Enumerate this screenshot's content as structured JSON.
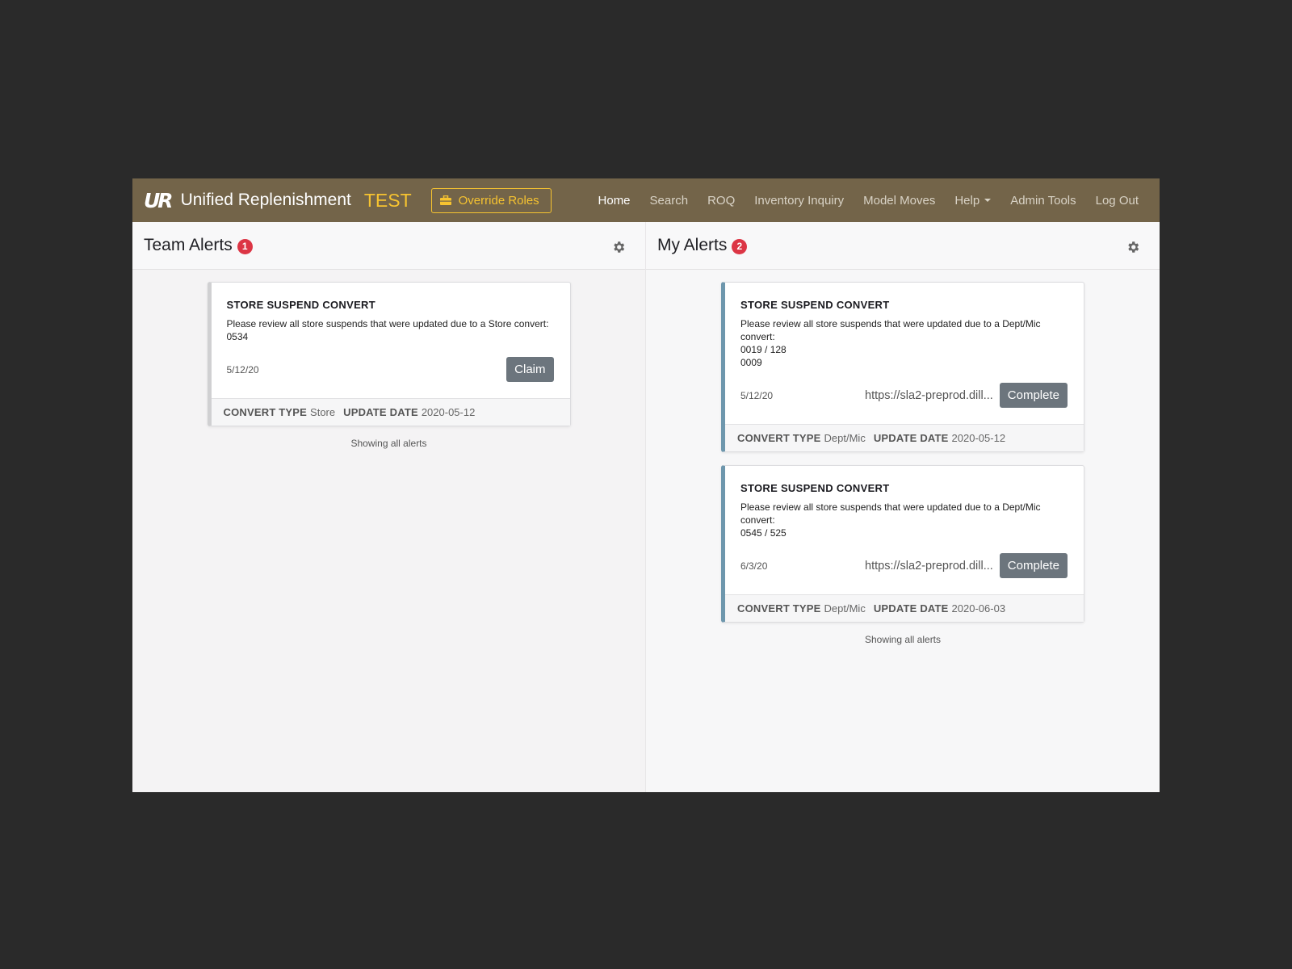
{
  "navbar": {
    "logo": "UR",
    "app_name": "Unified Replenishment",
    "env_tag": "TEST",
    "override_label": "Override Roles",
    "links": [
      "Home",
      "Search",
      "ROQ",
      "Inventory Inquiry",
      "Model Moves",
      "Help",
      "Admin Tools",
      "Log Out"
    ],
    "active": "Home"
  },
  "team_alerts": {
    "title": "Team Alerts",
    "count": "1",
    "cards": [
      {
        "title": "STORE SUSPEND CONVERT",
        "text": "Please review all store suspends that were updated due to a Store convert:\n0534",
        "date": "5/12/20",
        "action": "Claim",
        "convert_type_key": "CONVERT TYPE",
        "convert_type": "Store",
        "update_date_key": "UPDATE DATE",
        "update_date": "2020-05-12"
      }
    ],
    "footer": "Showing all alerts"
  },
  "my_alerts": {
    "title": "My Alerts",
    "count": "2",
    "cards": [
      {
        "title": "STORE SUSPEND CONVERT",
        "text": "Please review all store suspends that were updated due to a Dept/Mic convert:\n0019 / 128\n0009",
        "date": "5/12/20",
        "link": "https://sla2-preprod.dill...",
        "action": "Complete",
        "convert_type_key": "CONVERT TYPE",
        "convert_type": "Dept/Mic",
        "update_date_key": "UPDATE DATE",
        "update_date": "2020-05-12"
      },
      {
        "title": "STORE SUSPEND CONVERT",
        "text": "Please review all store suspends that were updated due to a Dept/Mic convert:\n0545 / 525",
        "date": "6/3/20",
        "link": "https://sla2-preprod.dill...",
        "action": "Complete",
        "convert_type_key": "CONVERT TYPE",
        "convert_type": "Dept/Mic",
        "update_date_key": "UPDATE DATE",
        "update_date": "2020-06-03"
      }
    ],
    "footer": "Showing all alerts"
  },
  "colors": {
    "navbar": "#736449",
    "accent": "#f6c330",
    "badge": "#dc3545",
    "assigned_border": "#6e97ad",
    "button": "#6c757d"
  },
  "icons": {
    "override": "toolbox-icon",
    "settings": "gear-icon"
  }
}
